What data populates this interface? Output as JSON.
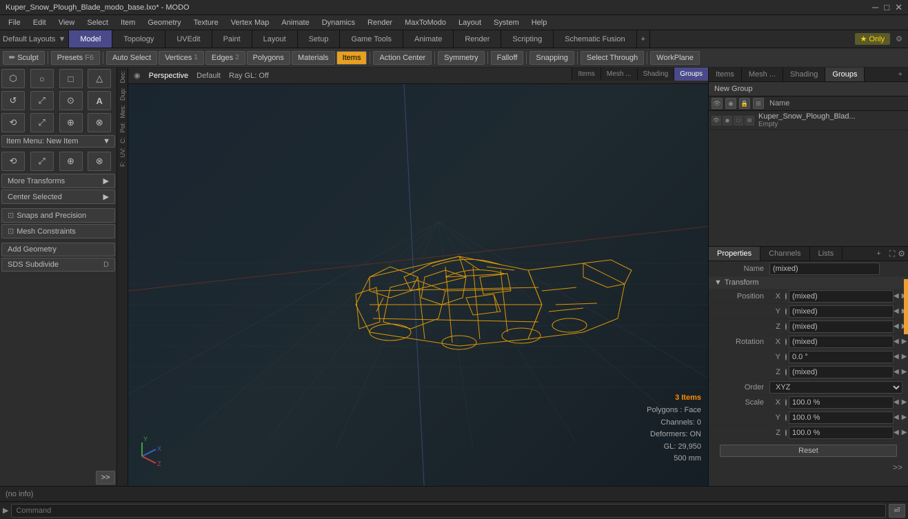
{
  "window": {
    "title": "Kuper_Snow_Plough_Blade_modo_base.lxo* - MODO"
  },
  "titlebar": {
    "win_controls": [
      "─",
      "□",
      "✕"
    ]
  },
  "menubar": {
    "items": [
      "File",
      "Edit",
      "View",
      "Select",
      "Item",
      "Geometry",
      "Texture",
      "Vertex Map",
      "Animate",
      "Dynamics",
      "Render",
      "MaxToModo",
      "Layout",
      "System",
      "Help"
    ]
  },
  "layout_dropdown": "Default Layouts",
  "tabs": {
    "items": [
      "Model",
      "Topology",
      "UVEdit",
      "Paint",
      "Layout",
      "Setup",
      "Game Tools",
      "Animate",
      "Render",
      "Scripting",
      "Schematic Fusion"
    ],
    "active": "Model",
    "add_label": "+",
    "only_label": "★ Only",
    "settings_icon": "⚙"
  },
  "toolbar": {
    "sculpt_label": "Sculpt",
    "presets_label": "Presets",
    "presets_key": "F6",
    "auto_select": "Auto Select",
    "vertices": "Vertices",
    "vertices_count": "1",
    "edges": "Edges",
    "edges_count": "2",
    "polygons": "Polygons",
    "materials": "Materials",
    "items": "Items",
    "action_center": "Action Center",
    "symmetry": "Symmetry",
    "falloff": "Falloff",
    "snapping": "Snapping",
    "select_through": "Select Through",
    "workplane": "WorkPlane"
  },
  "left_sidebar": {
    "tool_rows": [
      [
        "⬡",
        "○",
        "□",
        "△"
      ],
      [
        "↺",
        "⤢",
        "⊙",
        "A"
      ],
      [
        "⟲",
        "⤢",
        "⊕",
        "⊗"
      ]
    ],
    "item_menu_label": "Item Menu: New Item",
    "transform_tools": [
      "⟲",
      "⤢",
      "⊕",
      "⊗"
    ],
    "more_transforms": "More Transforms",
    "center_selected": "Center Selected",
    "snaps_precision": "Snaps and Precision",
    "mesh_constraints": "Mesh Constraints",
    "add_geometry": "Add Geometry",
    "sds_subdivide": "SDS Subdivide",
    "sds_key": "D",
    "expand_btn": ">>"
  },
  "viewport": {
    "perspective_label": "Perspective",
    "default_label": "Default",
    "ray_gl_label": "Ray GL: Off",
    "icons": [
      "⊙",
      "↺",
      "⤢",
      "✦",
      "⚙",
      "▦"
    ],
    "tabs_left": [
      "Items",
      "Mesh ...",
      "Shading",
      "Groups"
    ],
    "active_tab": "Groups"
  },
  "viewport_info": {
    "items": "3 Items",
    "polygons": "Polygons : Face",
    "channels": "Channels: 0",
    "deformers": "Deformers: ON",
    "gl": "GL: 29,950",
    "size": "500 mm"
  },
  "right_panel": {
    "tabs": [
      "Items",
      "Mesh ...",
      "Shading",
      "Groups"
    ],
    "active_tab": "Groups",
    "new_group_label": "New Group",
    "name_col_label": "Name",
    "group_row": {
      "name": "Kuper_Snow_Plough_Blad...",
      "sub": "Empty"
    }
  },
  "properties": {
    "tabs": [
      "Properties",
      "Channels",
      "Lists"
    ],
    "active_tab": "Properties",
    "add_icon": "+",
    "name_label": "Name",
    "name_value": "(mixed)",
    "transform_section": "Transform",
    "position": {
      "label": "Position",
      "x_label": "X",
      "x_value": "(mixed)",
      "y_label": "Y",
      "y_value": "(mixed)",
      "z_label": "Z",
      "z_value": "(mixed)"
    },
    "rotation": {
      "label": "Rotation",
      "x_label": "X",
      "x_value": "(mixed)",
      "y_label": "Y",
      "y_value": "0.0 °",
      "z_label": "Z",
      "z_value": "(mixed)"
    },
    "order_label": "Order",
    "order_value": "XYZ",
    "scale": {
      "label": "Scale",
      "x_label": "X",
      "x_value": "100.0 %",
      "y_label": "Y",
      "y_value": "100.0 %",
      "z_label": "Z",
      "z_value": "100.0 %"
    },
    "reset_label": "Reset",
    "double_arrow": ">>"
  },
  "statusbar": {
    "info": "(no info)"
  },
  "cmdbar": {
    "prompt_label": "▶",
    "placeholder": "Command"
  },
  "colors": {
    "active_tab_bg": "#4a4a8a",
    "orange_accent": "#f0a030",
    "mesh_color": "#ffaa00",
    "grid_color": "#2a3a45",
    "bg_viewport": "#1a2530",
    "active_items_btn": "#e8a020"
  }
}
